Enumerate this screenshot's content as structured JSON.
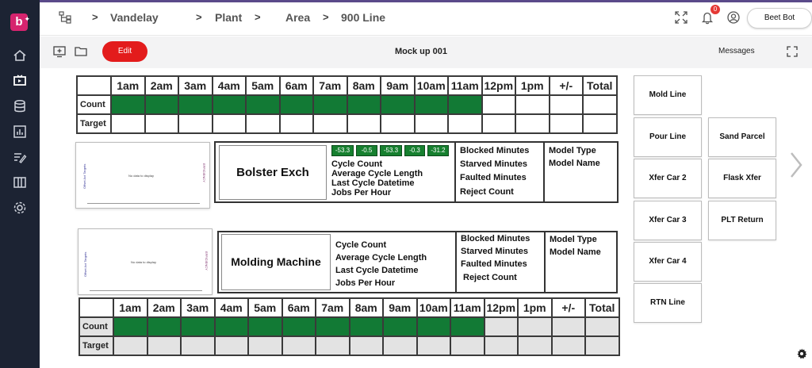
{
  "header": {
    "breadcrumbs": [
      "Vandelay",
      "Plant",
      "Area",
      "900 Line"
    ],
    "separators": [
      ">",
      ">",
      ">"
    ],
    "notification_count": "0",
    "user_button": "Beet Bot"
  },
  "toolbar": {
    "edit_label": "Edit",
    "view_title": "Mock up 001",
    "messages_label": "Messages"
  },
  "hours": [
    "1am",
    "2am",
    "3am",
    "4am",
    "5am",
    "6am",
    "7am",
    "8am",
    "9am",
    "10am",
    "11am",
    "12pm",
    "1pm",
    "+/-",
    "Total"
  ],
  "table_rows": {
    "count": "Count",
    "target": "Target"
  },
  "count_fill": {
    "filled_hours": 11,
    "of_hours": 15
  },
  "chart_placeholder": {
    "no_data": "No data to display",
    "y_left": "Offset Act Targets",
    "y_right": "EFFICIENCY"
  },
  "machines": [
    {
      "name": "Bolster Exch",
      "chips": [
        "-53.3",
        "-0.5",
        "-53.3",
        "-0.3",
        "-31.2"
      ],
      "metrics": [
        "Cycle Count",
        "Average Cycle Length",
        "Last Cycle Datetime",
        "Jobs Per Hour"
      ],
      "stats": [
        "Blocked Minutes",
        "Starved Minutes",
        "Faulted Minutes",
        "Reject Count"
      ],
      "model": [
        "Model Type",
        "Model Name"
      ]
    },
    {
      "name": "Molding Machine",
      "chips": [],
      "metrics": [
        "Cycle Count",
        "Average Cycle Length",
        "Last Cycle Datetime",
        "Jobs Per Hour"
      ],
      "stats": [
        "Blocked Minutes",
        "Starved Minutes",
        "Faulted Minutes",
        "Reject Count"
      ],
      "model": [
        "Model Type",
        "Model Name"
      ]
    }
  ],
  "nav_left": [
    "Mold Line",
    "Pour Line",
    "Xfer Car 2",
    "Xfer Car 3",
    "Xfer Car 4",
    "RTN Line"
  ],
  "nav_right": [
    "Sand Parcel",
    "Flask Xfer",
    "PLT Return"
  ],
  "colors": {
    "sidebar": "#1c2333",
    "brand": "#d6246e",
    "edit": "#e31c1c",
    "count_fill": "#127a35",
    "chip": "#16802f"
  }
}
